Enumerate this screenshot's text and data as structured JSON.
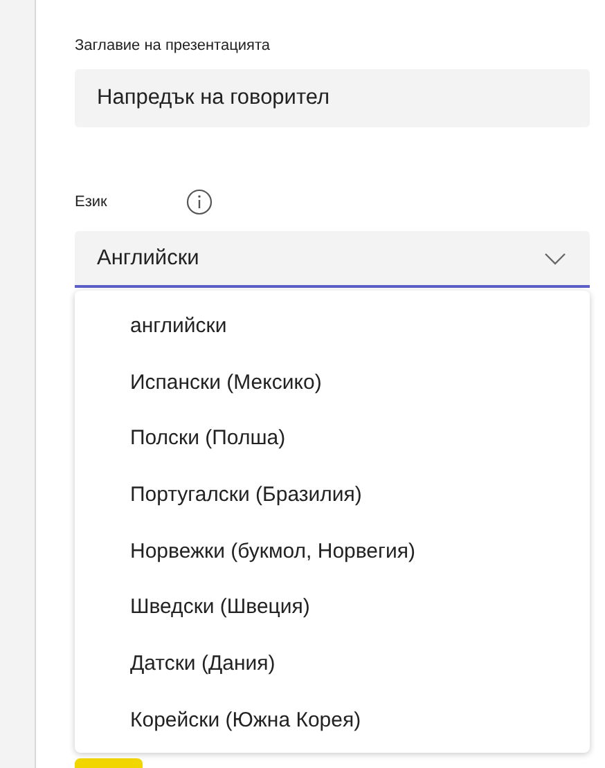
{
  "title_field": {
    "label": "Заглавие на презентацията",
    "value": "Напредък на говорител"
  },
  "language_field": {
    "label": "Език",
    "value": "Английски",
    "expanded": true
  },
  "language_options": [
    {
      "label": "английски"
    },
    {
      "label": "Испански (Мексико)"
    },
    {
      "label": "Полски (Полша)"
    },
    {
      "label": "Португалски (Бразилия)"
    },
    {
      "label": "Норвежки (букмол, Норвегия)"
    },
    {
      "label": "Шведски (Швеция)"
    },
    {
      "label": "Датски (Дания)"
    },
    {
      "label": "Корейски (Южна Корея)"
    }
  ]
}
